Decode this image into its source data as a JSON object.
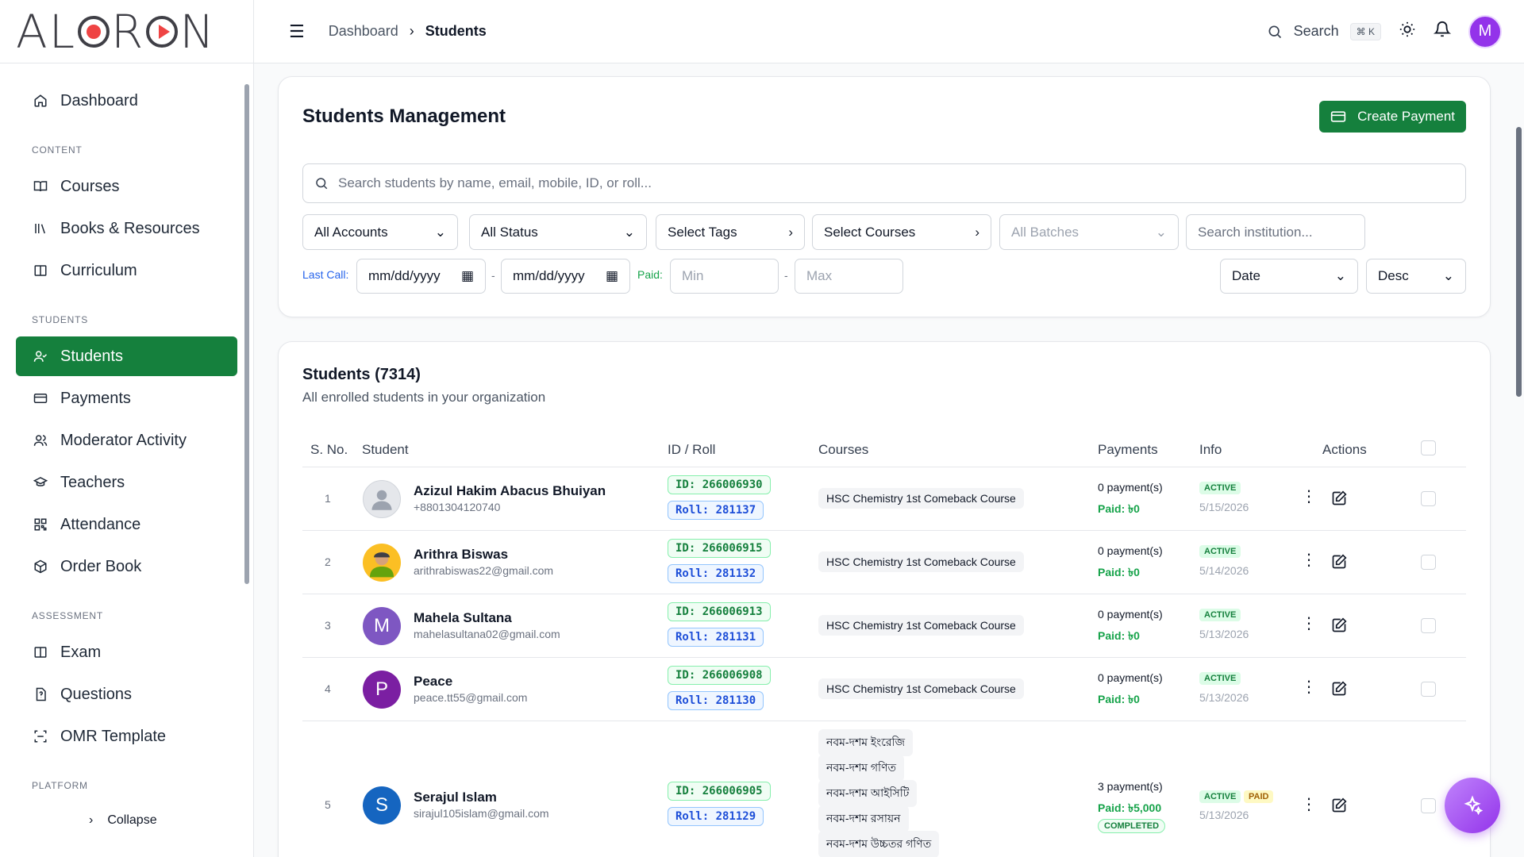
{
  "brand": {
    "logo_text": "ALORON"
  },
  "sidebar": {
    "items_top": [
      {
        "label": "Dashboard"
      }
    ],
    "sections": [
      {
        "title": "CONTENT",
        "items": [
          {
            "label": "Courses"
          },
          {
            "label": "Books & Resources"
          },
          {
            "label": "Curriculum"
          }
        ]
      },
      {
        "title": "STUDENTS",
        "items": [
          {
            "label": "Students"
          },
          {
            "label": "Payments"
          },
          {
            "label": "Moderator Activity"
          },
          {
            "label": "Teachers"
          },
          {
            "label": "Attendance"
          },
          {
            "label": "Order Book"
          }
        ]
      },
      {
        "title": "ASSESSMENT",
        "items": [
          {
            "label": "Exam"
          },
          {
            "label": "Questions"
          },
          {
            "label": "OMR Template"
          }
        ]
      },
      {
        "title": "PLATFORM",
        "items": []
      }
    ],
    "collapse_label": "Collapse"
  },
  "topbar": {
    "breadcrumb": [
      "Dashboard",
      "Students"
    ],
    "search_label": "Search",
    "shortcut": "⌘ K",
    "avatar_initial": "M"
  },
  "filters": {
    "title": "Students Management",
    "create_button": "Create Payment",
    "search_placeholder": "Search students by name, email, mobile, ID, or roll...",
    "accounts": "All Accounts",
    "status": "All Status",
    "tags": "Select Tags",
    "courses": "Select Courses",
    "batches": "All Batches",
    "institution_placeholder": "Search institution...",
    "last_call_label": "Last Call:",
    "date_from": "mm/dd/yyyy",
    "date_to": "mm/dd/yyyy",
    "paid_label": "Paid:",
    "min_placeholder": "Min",
    "max_placeholder": "Max",
    "sort_field": "Date",
    "sort_order": "Desc",
    "range_sep": "-"
  },
  "table": {
    "title": "Students (7314)",
    "subtitle": "All enrolled students in your organization",
    "columns": [
      "S. No.",
      "Student",
      "ID / Roll",
      "Courses",
      "Payments",
      "Info",
      "Actions"
    ],
    "rows": [
      {
        "sn": "1",
        "name": "Azizul Hakim Abacus Bhuiyan",
        "contact": "+8801304120740",
        "avatar": "",
        "id": "ID: 266006930",
        "roll": "Roll: 281137",
        "courses": [
          "HSC Chemistry 1st Comeback Course"
        ],
        "payments": "0 payment(s)",
        "paid": "Paid: ৳0",
        "status": "ACTIVE",
        "date": "5/15/2026"
      },
      {
        "sn": "2",
        "name": "Arithra Biswas",
        "contact": "arithrabiswas22@gmail.com",
        "avatar": "",
        "id": "ID: 266006915",
        "roll": "Roll: 281132",
        "courses": [
          "HSC Chemistry 1st Comeback Course"
        ],
        "payments": "0 payment(s)",
        "paid": "Paid: ৳0",
        "status": "ACTIVE",
        "date": "5/14/2026"
      },
      {
        "sn": "3",
        "name": "Mahela Sultana",
        "contact": "mahelasultana02@gmail.com",
        "avatar": "M",
        "id": "ID: 266006913",
        "roll": "Roll: 281131",
        "courses": [
          "HSC Chemistry 1st Comeback Course"
        ],
        "payments": "0 payment(s)",
        "paid": "Paid: ৳0",
        "status": "ACTIVE",
        "date": "5/13/2026"
      },
      {
        "sn": "4",
        "name": "Peace",
        "contact": "peace.tt55@gmail.com",
        "avatar": "P",
        "id": "ID: 266006908",
        "roll": "Roll: 281130",
        "courses": [
          "HSC Chemistry 1st Comeback Course"
        ],
        "payments": "0 payment(s)",
        "paid": "Paid: ৳0",
        "status": "ACTIVE",
        "date": "5/13/2026"
      },
      {
        "sn": "5",
        "name": "Serajul Islam",
        "contact": "sirajul105islam@gmail.com",
        "avatar": "S",
        "id": "ID: 266006905",
        "roll": "Roll: 281129",
        "courses": [
          "নবম-দশম ইংরেজি",
          "নবম-দশম গণিত",
          "নবম-দশম আইসিটি",
          "নবম-দশম রসায়ন",
          "নবম-দশম উচ্চতর গণিত"
        ],
        "payments": "3 payment(s)",
        "paid": "Paid: ৳5,000",
        "payment_status": "COMPLETED",
        "status": "ACTIVE",
        "status2": "PAID",
        "date": "5/13/2026"
      }
    ]
  },
  "colors": {
    "accent": "#15803d",
    "purple": "#9333ea",
    "link": "#2563eb"
  }
}
